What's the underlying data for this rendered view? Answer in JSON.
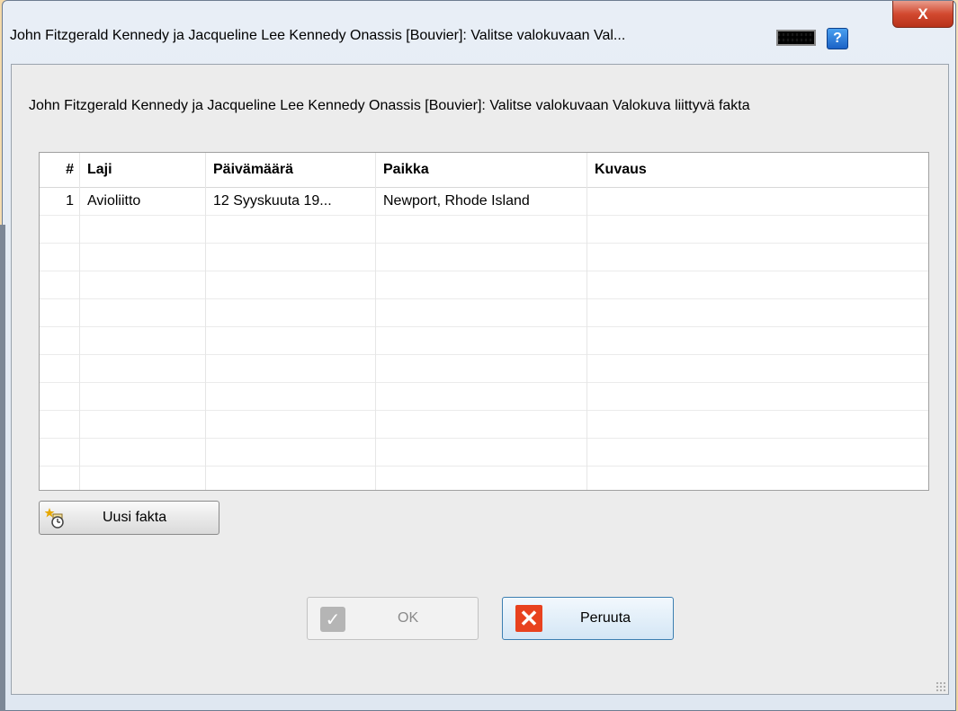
{
  "window": {
    "title": "John Fitzgerald Kennedy ja Jacqueline Lee Kennedy Onassis [Bouvier]: Valitse valokuvaan Val...",
    "help_label": "?",
    "close_label": "X"
  },
  "description": "John Fitzgerald Kennedy ja Jacqueline Lee Kennedy Onassis [Bouvier]: Valitse valokuvaan Valokuva liittyvä fakta",
  "table": {
    "columns": [
      "#",
      "Laji",
      "Päivämäärä",
      "Paikka",
      "Kuvaus"
    ],
    "rows": [
      [
        "1",
        "Avioliitto",
        "12 Syyskuuta 19...",
        "Newport, Rhode Island",
        ""
      ],
      [
        "",
        "",
        "",
        "",
        ""
      ],
      [
        "",
        "",
        "",
        "",
        ""
      ],
      [
        "",
        "",
        "",
        "",
        ""
      ],
      [
        "",
        "",
        "",
        "",
        ""
      ],
      [
        "",
        "",
        "",
        "",
        ""
      ],
      [
        "",
        "",
        "",
        "",
        ""
      ],
      [
        "",
        "",
        "",
        "",
        ""
      ],
      [
        "",
        "",
        "",
        "",
        ""
      ],
      [
        "",
        "",
        "",
        "",
        ""
      ],
      [
        "",
        "",
        "",
        "",
        ""
      ]
    ]
  },
  "buttons": {
    "new_fact": "Uusi fakta",
    "ok": "OK",
    "cancel": "Peruuta"
  },
  "icons": {
    "keyboard": "keyboard-icon",
    "help": "help-icon",
    "close": "close-icon",
    "new_fact": "new-fact-icon",
    "ok": "checkmark-icon",
    "cancel": "cancel-x-icon"
  },
  "colors": {
    "cancel_icon": "#e8421f",
    "help_icon": "#1b62c6",
    "close_button": "#d2492f"
  }
}
